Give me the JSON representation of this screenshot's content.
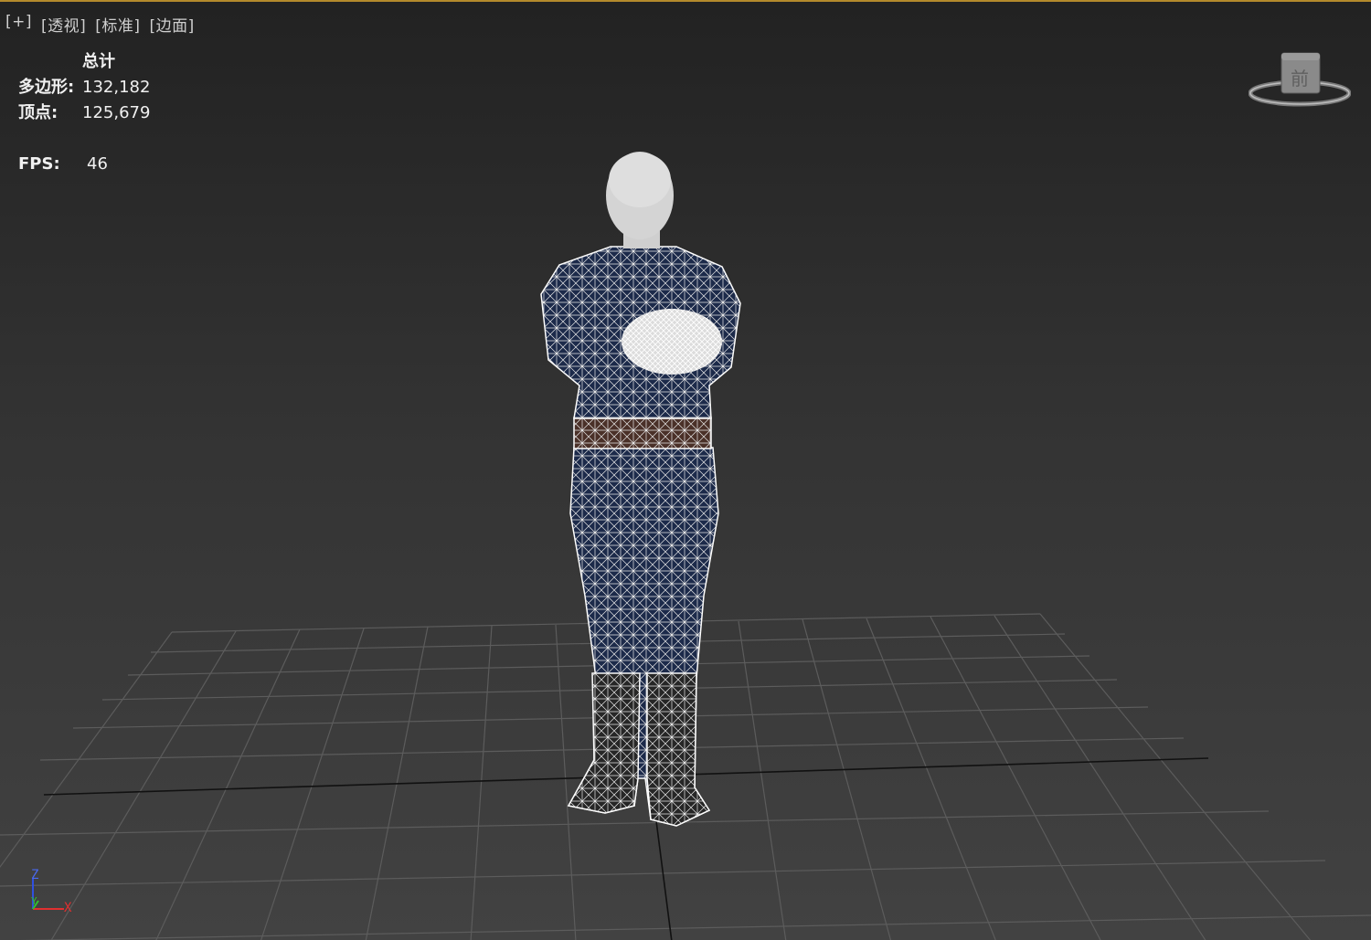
{
  "viewport": {
    "labels": [
      "[+]",
      "[透视]",
      "[标准]",
      "[边面]"
    ]
  },
  "stats": {
    "header": "总计",
    "polygons_label": "多边形:",
    "polygons_value": "132,182",
    "vertices_label": "顶点:",
    "vertices_value": "125,679",
    "fps_label": "FPS:",
    "fps_value": "46"
  },
  "viewcube": {
    "face_label": "前"
  },
  "axes": {
    "z": "Z",
    "y": "Y",
    "x": "X"
  },
  "colors": {
    "frame_accent": "#b48a2c",
    "grid_line": "#5a5a5a",
    "wireframe": "#ffffff",
    "suit": "#1c2a4a",
    "axis_x": "#e03030",
    "axis_y": "#30c030",
    "axis_z": "#3050e0"
  }
}
